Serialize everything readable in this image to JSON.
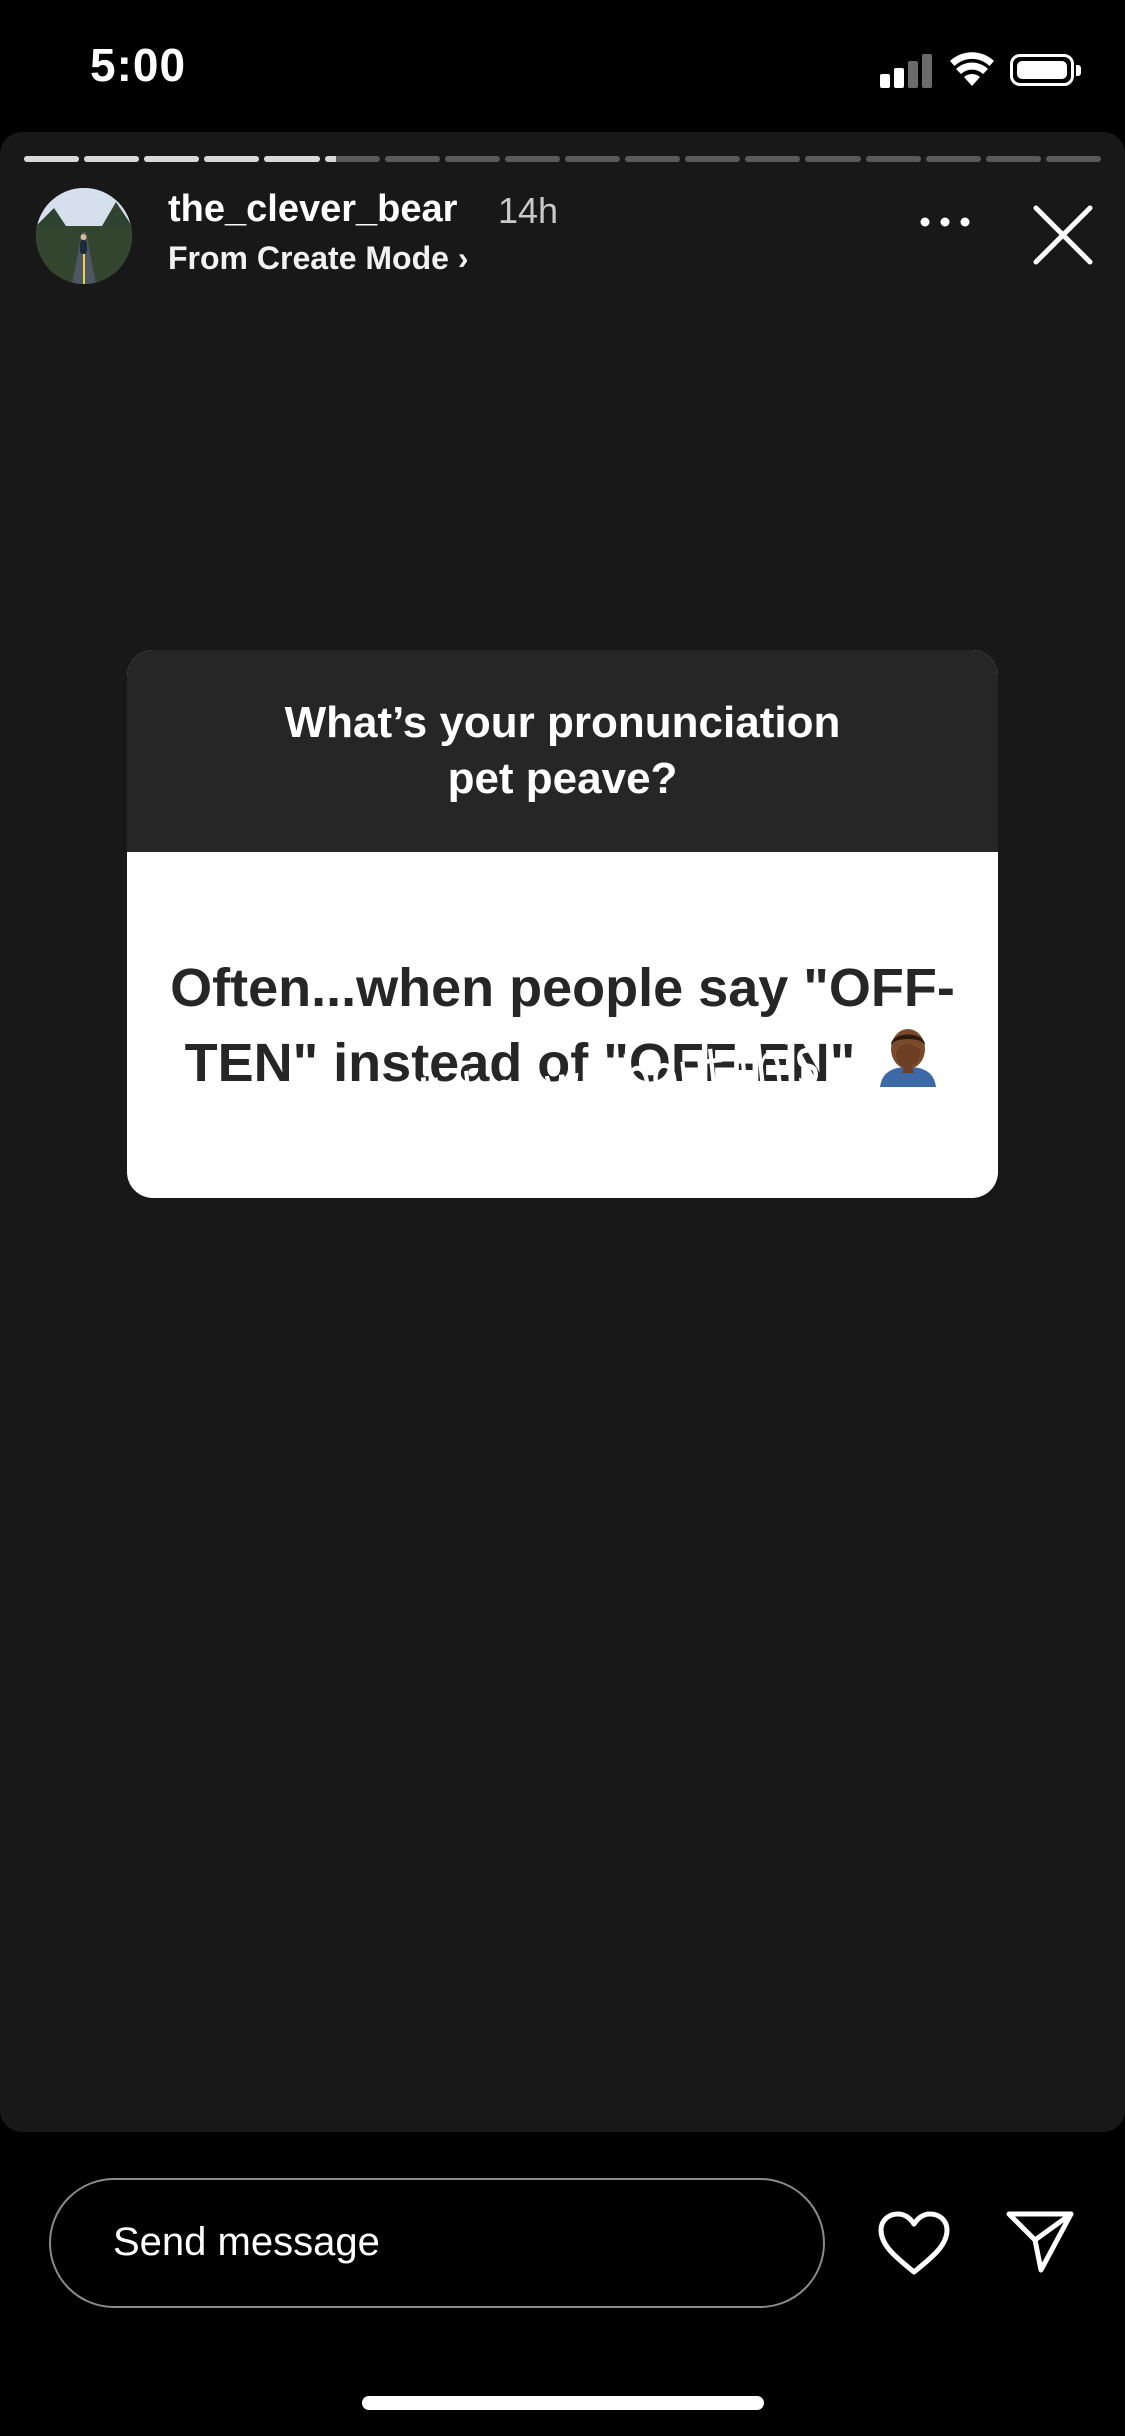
{
  "status_bar": {
    "time": "5:00"
  },
  "story": {
    "progress": {
      "segments": 18,
      "completed": 5,
      "current_fraction": 0.2
    },
    "user": {
      "username": "the_clever_bear",
      "time_ago": "14h",
      "subtitle": "From Create Mode ›"
    },
    "question_card": {
      "question": "What’s your pronunciation pet peave?",
      "answer": "Often...when people say \"OFF-TEN\" instead of \"OFF-EN\""
    },
    "caption": "I didn’t know about this one too!"
  },
  "bottom_bar": {
    "message_placeholder": "Send message"
  },
  "colors": {
    "background": "#000000",
    "story_background": "#181818",
    "card_header": "#262626",
    "card_body": "#ffffff"
  },
  "icons": [
    "signal-icon",
    "wifi-icon",
    "battery-icon",
    "more-icon",
    "close-icon",
    "facepalm-emoji-icon",
    "heart-icon",
    "send-icon"
  ]
}
